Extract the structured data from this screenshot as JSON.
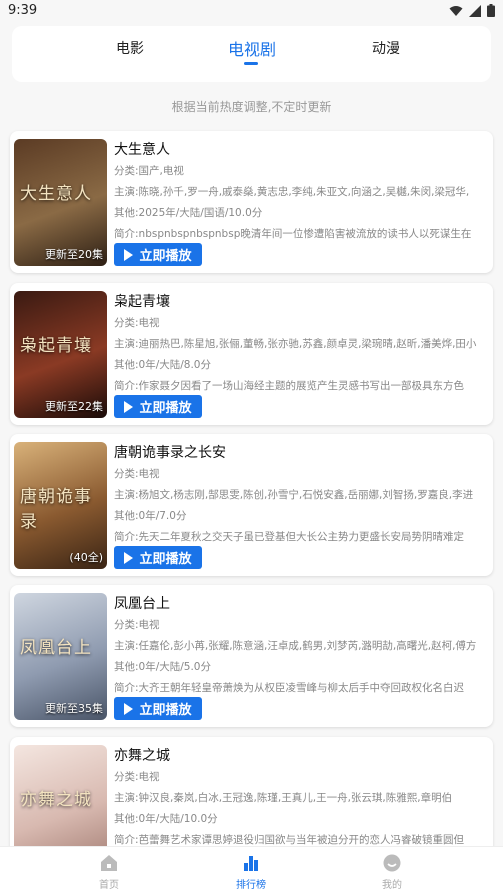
{
  "status": {
    "time": "9:39"
  },
  "tabs": [
    {
      "label": "电影"
    },
    {
      "label": "电视剧"
    },
    {
      "label": "动漫"
    }
  ],
  "notice": "根据当前热度调整,不定时更新",
  "play_label": "立即播放",
  "items": [
    {
      "title": "大生意人",
      "category": "分类:国产,电视",
      "cast": "主演:陈晓,孙千,罗一舟,戚泰燊,黄志忠,李纯,朱亚文,向涵之,吴樾,朱闵,梁冠华,",
      "other": "其他:2025年/大陆/国语/10.0分",
      "intro": "简介:nbspnbspnbspnbsp晚清年间一位惨遭陷害被流放的读书人以死谋生在",
      "poster_title": "大生意人",
      "update": "更新至20集",
      "colors": [
        "#5b3b24",
        "#8a6a45",
        "#2d1f14"
      ]
    },
    {
      "title": "枭起青壤",
      "category": "分类:电视",
      "cast": "主演:迪丽热巴,陈星旭,张俪,董畅,张亦驰,苏鑫,颜卓灵,梁琬晴,赵昕,潘美烨,田小",
      "other": "其他:0年/大陆/8.0分",
      "intro": "简介:作家聂夕因看了一场山海经主题的展览产生灵感书写出一部极具东方色",
      "poster_title": "枭起青壤",
      "update": "更新至22集",
      "colors": [
        "#3a1a12",
        "#8a3a24",
        "#1a0b08"
      ]
    },
    {
      "title": "唐朝诡事录之长安",
      "category": "分类:电视",
      "cast": "主演:杨旭文,杨志刚,郜思雯,陈创,孙雪宁,石悦安鑫,岳丽娜,刘智扬,罗嘉良,李进",
      "other": "其他:0年/7.0分",
      "intro": "简介:先天二年夏秋之交天子虽已登基但大长公主势力更盛长安局势阴晴难定",
      "poster_title": "唐朝诡事录",
      "update": "(40全)",
      "colors": [
        "#d9b27a",
        "#8a5a30",
        "#3a2414"
      ]
    },
    {
      "title": "凤凰台上",
      "category": "分类:电视",
      "cast": "主演:任嘉伦,彭小苒,张耀,陈意涵,汪卓成,鹤男,刘梦芮,潞明劼,高曙光,赵柯,傅方",
      "other": "其他:0年/大陆/5.0分",
      "intro": "简介:大齐王朝年轻皇帝萧焕为从权臣凌雪峰与柳太后手中夺回政权化名白迟",
      "poster_title": "凤凰台上",
      "update": "更新至35集",
      "colors": [
        "#cfd6e0",
        "#8f9bb0",
        "#4a5568"
      ]
    },
    {
      "title": "亦舞之城",
      "category": "分类:电视",
      "cast": "主演:钟汉良,秦岚,白冰,王冠逸,陈瑾,王真儿,王一舟,张云琪,陈雅熙,章明伯",
      "other": "其他:0年/大陆/10.0分",
      "intro": "简介:芭蕾舞艺术家谭思婷退役归国欲与当年被迫分开的恋人冯睿破镜重圆但",
      "poster_title": "亦舞之城",
      "update": "",
      "colors": [
        "#f4e6e0",
        "#d8b9b0",
        "#a07a70"
      ]
    }
  ],
  "nav": [
    {
      "label": "首页"
    },
    {
      "label": "排行榜"
    },
    {
      "label": "我的"
    }
  ]
}
